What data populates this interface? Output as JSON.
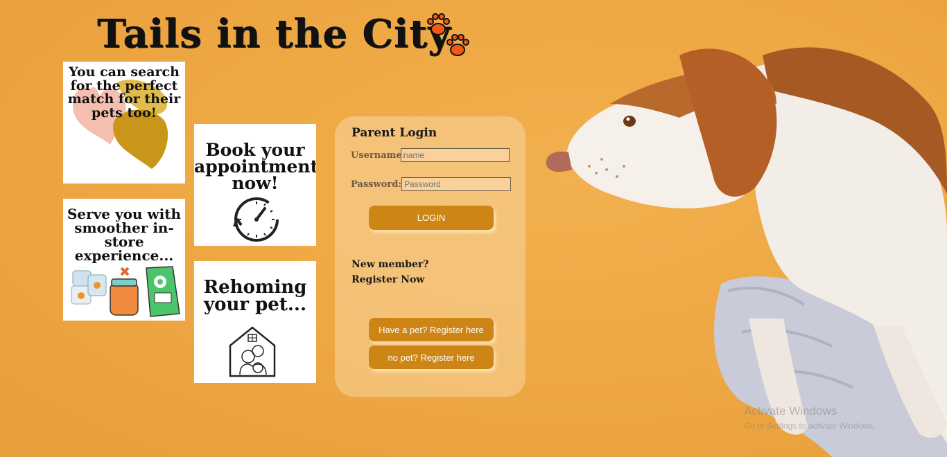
{
  "header": {
    "logo_text": "Tails in the City",
    "paw_icon": "paw-prints-icon",
    "paw_color": "#f05a14"
  },
  "cards": [
    {
      "title": "You can search for the perfect match for their pets too!",
      "icon": "hearts-illustration"
    },
    {
      "title": "Book your appointment now!",
      "icon": "clock-icon"
    },
    {
      "title": "Serve you with smoother in-store experience...",
      "icon": "pet-products-illustration"
    },
    {
      "title": "Rehoming your pet...",
      "icon": "pet-house-icon"
    }
  ],
  "login": {
    "title": "Parent Login",
    "username_label": "Username:",
    "username_placeholder": "name",
    "password_label": "Password:",
    "password_placeholder": "Password",
    "login_button": "LOGIN",
    "new_member_line1": "New member?",
    "new_member_line2": "Register Now",
    "register_with_pet": "Have a pet? Register here",
    "register_no_pet": "no pet? Register here"
  },
  "watermark": {
    "line1": "Activate Windows",
    "line2": "Go to Settings to activate Windows."
  },
  "colors": {
    "background": "#eea844",
    "button": "#cd8515",
    "panel": "#f8d6a0"
  }
}
